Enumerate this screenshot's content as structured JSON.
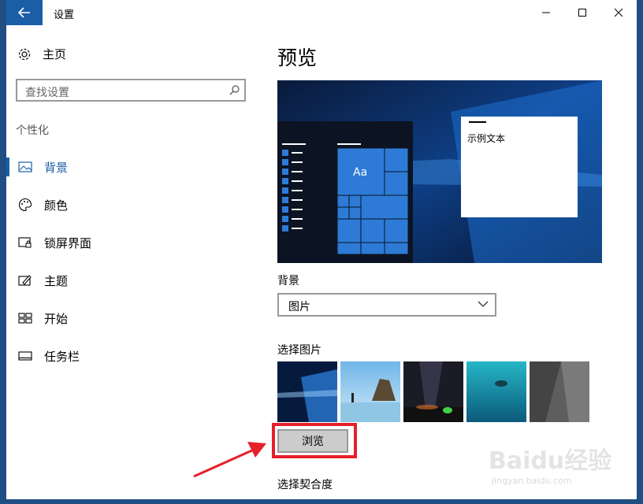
{
  "window": {
    "title": "设置"
  },
  "sidebar": {
    "home_label": "主页",
    "search_placeholder": "查找设置",
    "section_title": "个性化",
    "items": [
      {
        "label": "背景",
        "icon": "picture-icon",
        "selected": true
      },
      {
        "label": "颜色",
        "icon": "palette-icon",
        "selected": false
      },
      {
        "label": "锁屏界面",
        "icon": "lock-screen-icon",
        "selected": false
      },
      {
        "label": "主题",
        "icon": "theme-icon",
        "selected": false
      },
      {
        "label": "开始",
        "icon": "start-icon",
        "selected": false
      },
      {
        "label": "任务栏",
        "icon": "taskbar-icon",
        "selected": false
      }
    ]
  },
  "main": {
    "heading": "预览",
    "preview": {
      "sample_text": "示例文本",
      "tile_text": "Aa"
    },
    "background_label": "背景",
    "background_value": "图片",
    "choose_picture_label": "选择图片",
    "browse_label": "浏览",
    "choose_fit_label": "选择契合度"
  },
  "watermark": {
    "text": "Baidu经验",
    "sub": "jingyan.baidu.com"
  },
  "colors": {
    "accent": "#1b5ea8",
    "highlight": "#e5202a"
  }
}
